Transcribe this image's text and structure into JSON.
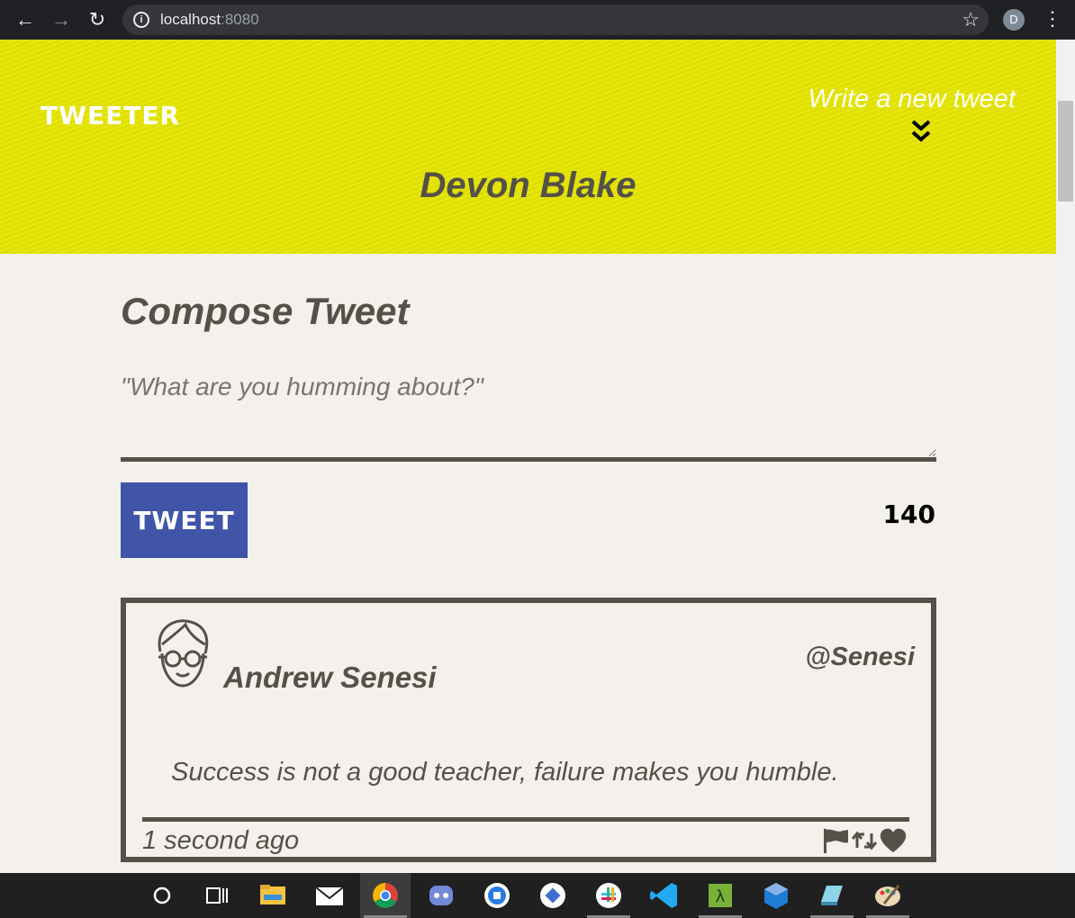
{
  "browser": {
    "url_host": "localhost",
    "url_port": ":8080",
    "profile_initial": "D",
    "info_glyph": "i"
  },
  "header": {
    "brand": "TWEETER",
    "write_link": "Write a new tweet",
    "username": "Devon Blake",
    "background_color": "#e6e600"
  },
  "compose": {
    "title": "Compose Tweet",
    "placeholder": "\"What are you humming about?\"",
    "button_label": "TWEET",
    "counter": "140",
    "button_color": "#4054a8"
  },
  "tweets": [
    {
      "name": "Andrew Senesi",
      "handle": "@Senesi",
      "content": "Success is not a good teacher, failure makes you humble.",
      "time": "1 second ago"
    }
  ],
  "taskbar": {
    "apps": [
      "cortana",
      "task-view",
      "file-explorer",
      "mail",
      "chrome",
      "discord",
      "app-blue",
      "app-blue-2",
      "slack",
      "vscode",
      "lambda-app",
      "virtualbox",
      "notepad",
      "paint"
    ]
  }
}
